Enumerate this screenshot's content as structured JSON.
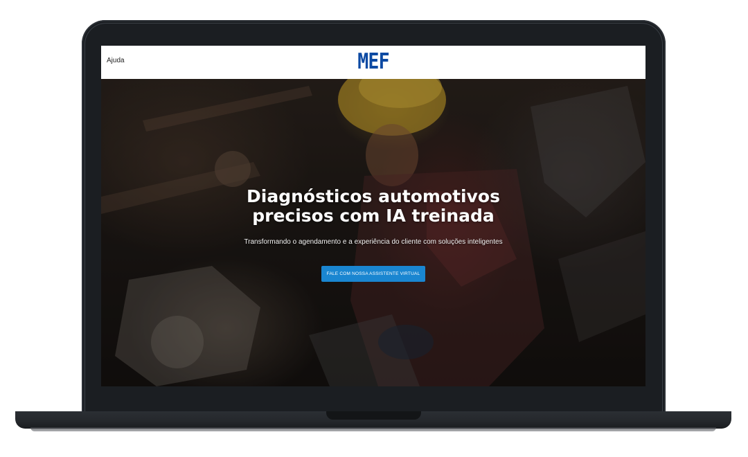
{
  "header": {
    "help_label": "Ajuda",
    "logo_text": "MEF"
  },
  "hero": {
    "title_line1": "Diagnósticos automotivos",
    "title_line2": "precisos com IA treinada",
    "subtitle": "Transformando o agendamento e a experiência do cliente com soluções inteligentes",
    "cta_label": "FALE COM NOSSA ASSISTENTE VIRTUAL"
  },
  "colors": {
    "brand_blue": "#0d4aa3",
    "cta_blue": "#1a86d1",
    "laptop_frame": "#1b1e22"
  }
}
